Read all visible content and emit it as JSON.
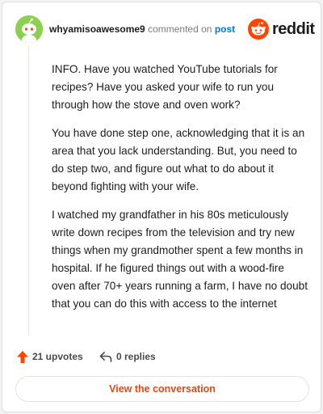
{
  "header": {
    "username": "whyamisoawesome9",
    "commented_on": "commented on",
    "post_link": "post",
    "brand": "reddit"
  },
  "comment": {
    "paragraphs": [
      "INFO. Have you watched YouTube tutorials for recipes? Have you asked your wife to run you through how the stove and oven work?",
      "You have done step one, acknowledging that it is an area that you lack understanding. But, you need to do step two, and figure out what to do about it beyond fighting with your wife.",
      "I watched my grandfather in his 80s meticulously write down recipes from the television and try new things when my grandmother spent a few months in hospital. If he figured things out with a wood-fire oven after 70+ years running a farm, I have no doubt that you can do this with access to the internet"
    ]
  },
  "actions": {
    "upvotes": "21 upvotes",
    "replies": "0 replies"
  },
  "view_button": "View the conversation",
  "colors": {
    "accent": "#e0491a",
    "reddit_orange": "#ff4500",
    "avatar": "#8bd14f",
    "link": "#0079d3"
  },
  "icons": [
    "snoo-avatar-icon",
    "reddit-logo-icon",
    "upvote-arrow-icon",
    "reply-arrow-icon"
  ]
}
